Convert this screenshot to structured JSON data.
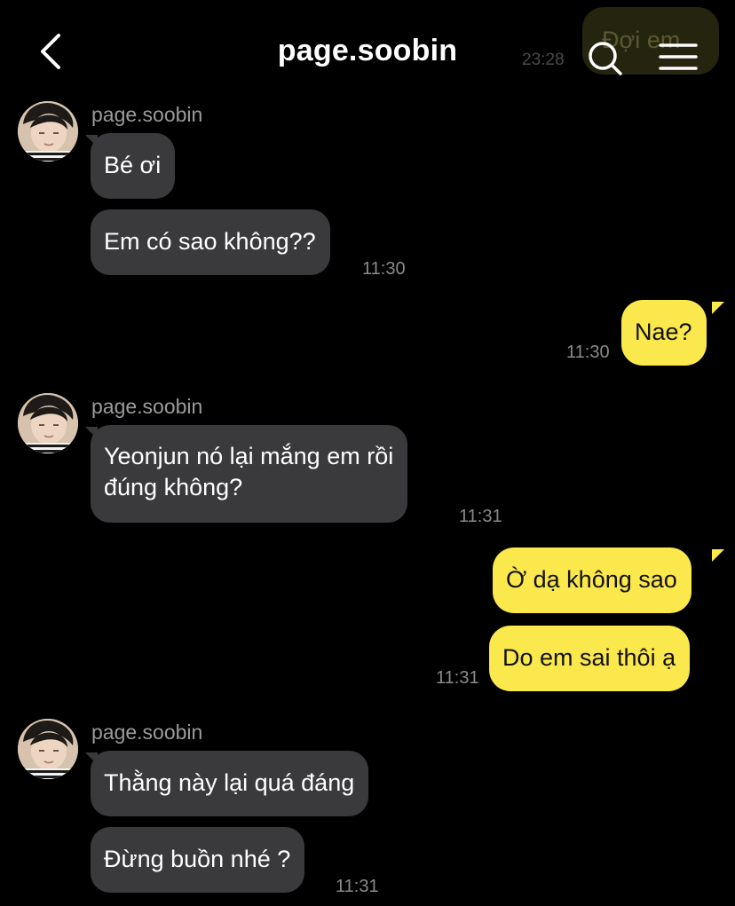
{
  "header": {
    "title": "page.soobin"
  },
  "ghost_message": {
    "text": "Đợi em",
    "time": "23:28"
  },
  "messages": [
    {
      "direction": "in",
      "sender": "page.soobin",
      "bubbles": [
        "Bé ơi",
        "Em có sao không??"
      ],
      "time": "11:30"
    },
    {
      "direction": "out",
      "bubbles": [
        "Nae?"
      ],
      "time": "11:30"
    },
    {
      "direction": "in",
      "sender": "page.soobin",
      "bubbles": [
        "Yeonjun nó lại mắng em rồi\nđúng không?"
      ],
      "time": "11:31"
    },
    {
      "direction": "out",
      "bubbles": [
        "Ờ dạ không sao",
        "Do em sai thôi ạ"
      ],
      "time": "11:31"
    },
    {
      "direction": "in",
      "sender": "page.soobin",
      "bubbles": [
        "Thằng này lại quá đáng",
        "Đừng buồn nhé ?"
      ],
      "time": "11:31"
    }
  ],
  "colors": {
    "background": "#000000",
    "incoming_bubble": "#3a3a3c",
    "outgoing_bubble": "#fbe84c",
    "timestamp": "#8a8a8a"
  },
  "icons": {
    "back": "chevron-left-icon",
    "search": "search-icon",
    "menu": "hamburger-menu-icon"
  }
}
